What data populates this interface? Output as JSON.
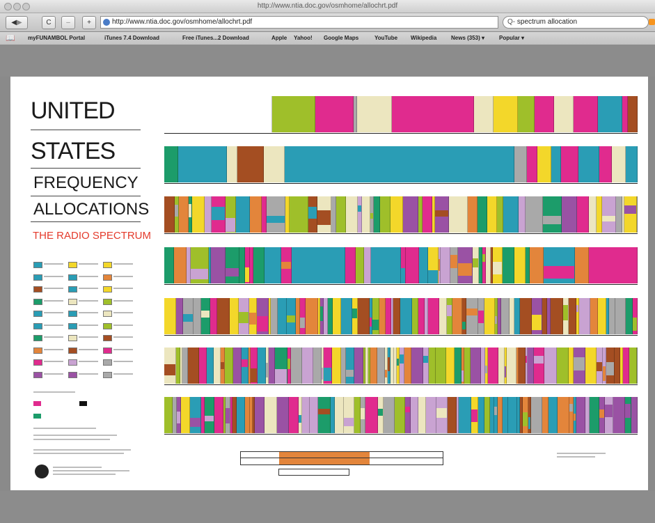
{
  "window": {
    "title": "http://www.ntia.doc.gov/osmhome/allochrt.pdf"
  },
  "toolbar": {
    "url": "http://www.ntia.doc.gov/osmhome/allochrt.pdf",
    "search_value": "spectrum allocation",
    "search_prefix": "Q‑",
    "back_icon": "back-arrow-icon",
    "forward_icon": "forward-arrow-icon",
    "reload_label": "C",
    "add_label": "+"
  },
  "bookmarks": [
    "myFUNAMBOL Portal",
    "iTunes 7.4 Download",
    "Free iTunes...2 Download",
    "Apple",
    "Yahoo!",
    "Google Maps",
    "YouTube",
    "Wikipedia",
    "News (353) ▾",
    "Popular ▾"
  ],
  "poster": {
    "line1": "UNITED",
    "line2": "STATES",
    "line3": "FREQUENCY",
    "line4": "ALLOCATIONS",
    "subtitle": "THE RADIO SPECTRUM"
  },
  "colors": {
    "magenta": "#e02b8e",
    "teal": "#2a9db5",
    "olive": "#9fbf2a",
    "cream": "#ece6bf",
    "yellow": "#f3d72a",
    "orange": "#e3853b",
    "brown": "#a44e22",
    "purple": "#9a52a4",
    "lavender": "#c9a3d2",
    "green": "#1c9c6a",
    "grey": "#a9a9a9",
    "white": "#ffffff"
  }
}
